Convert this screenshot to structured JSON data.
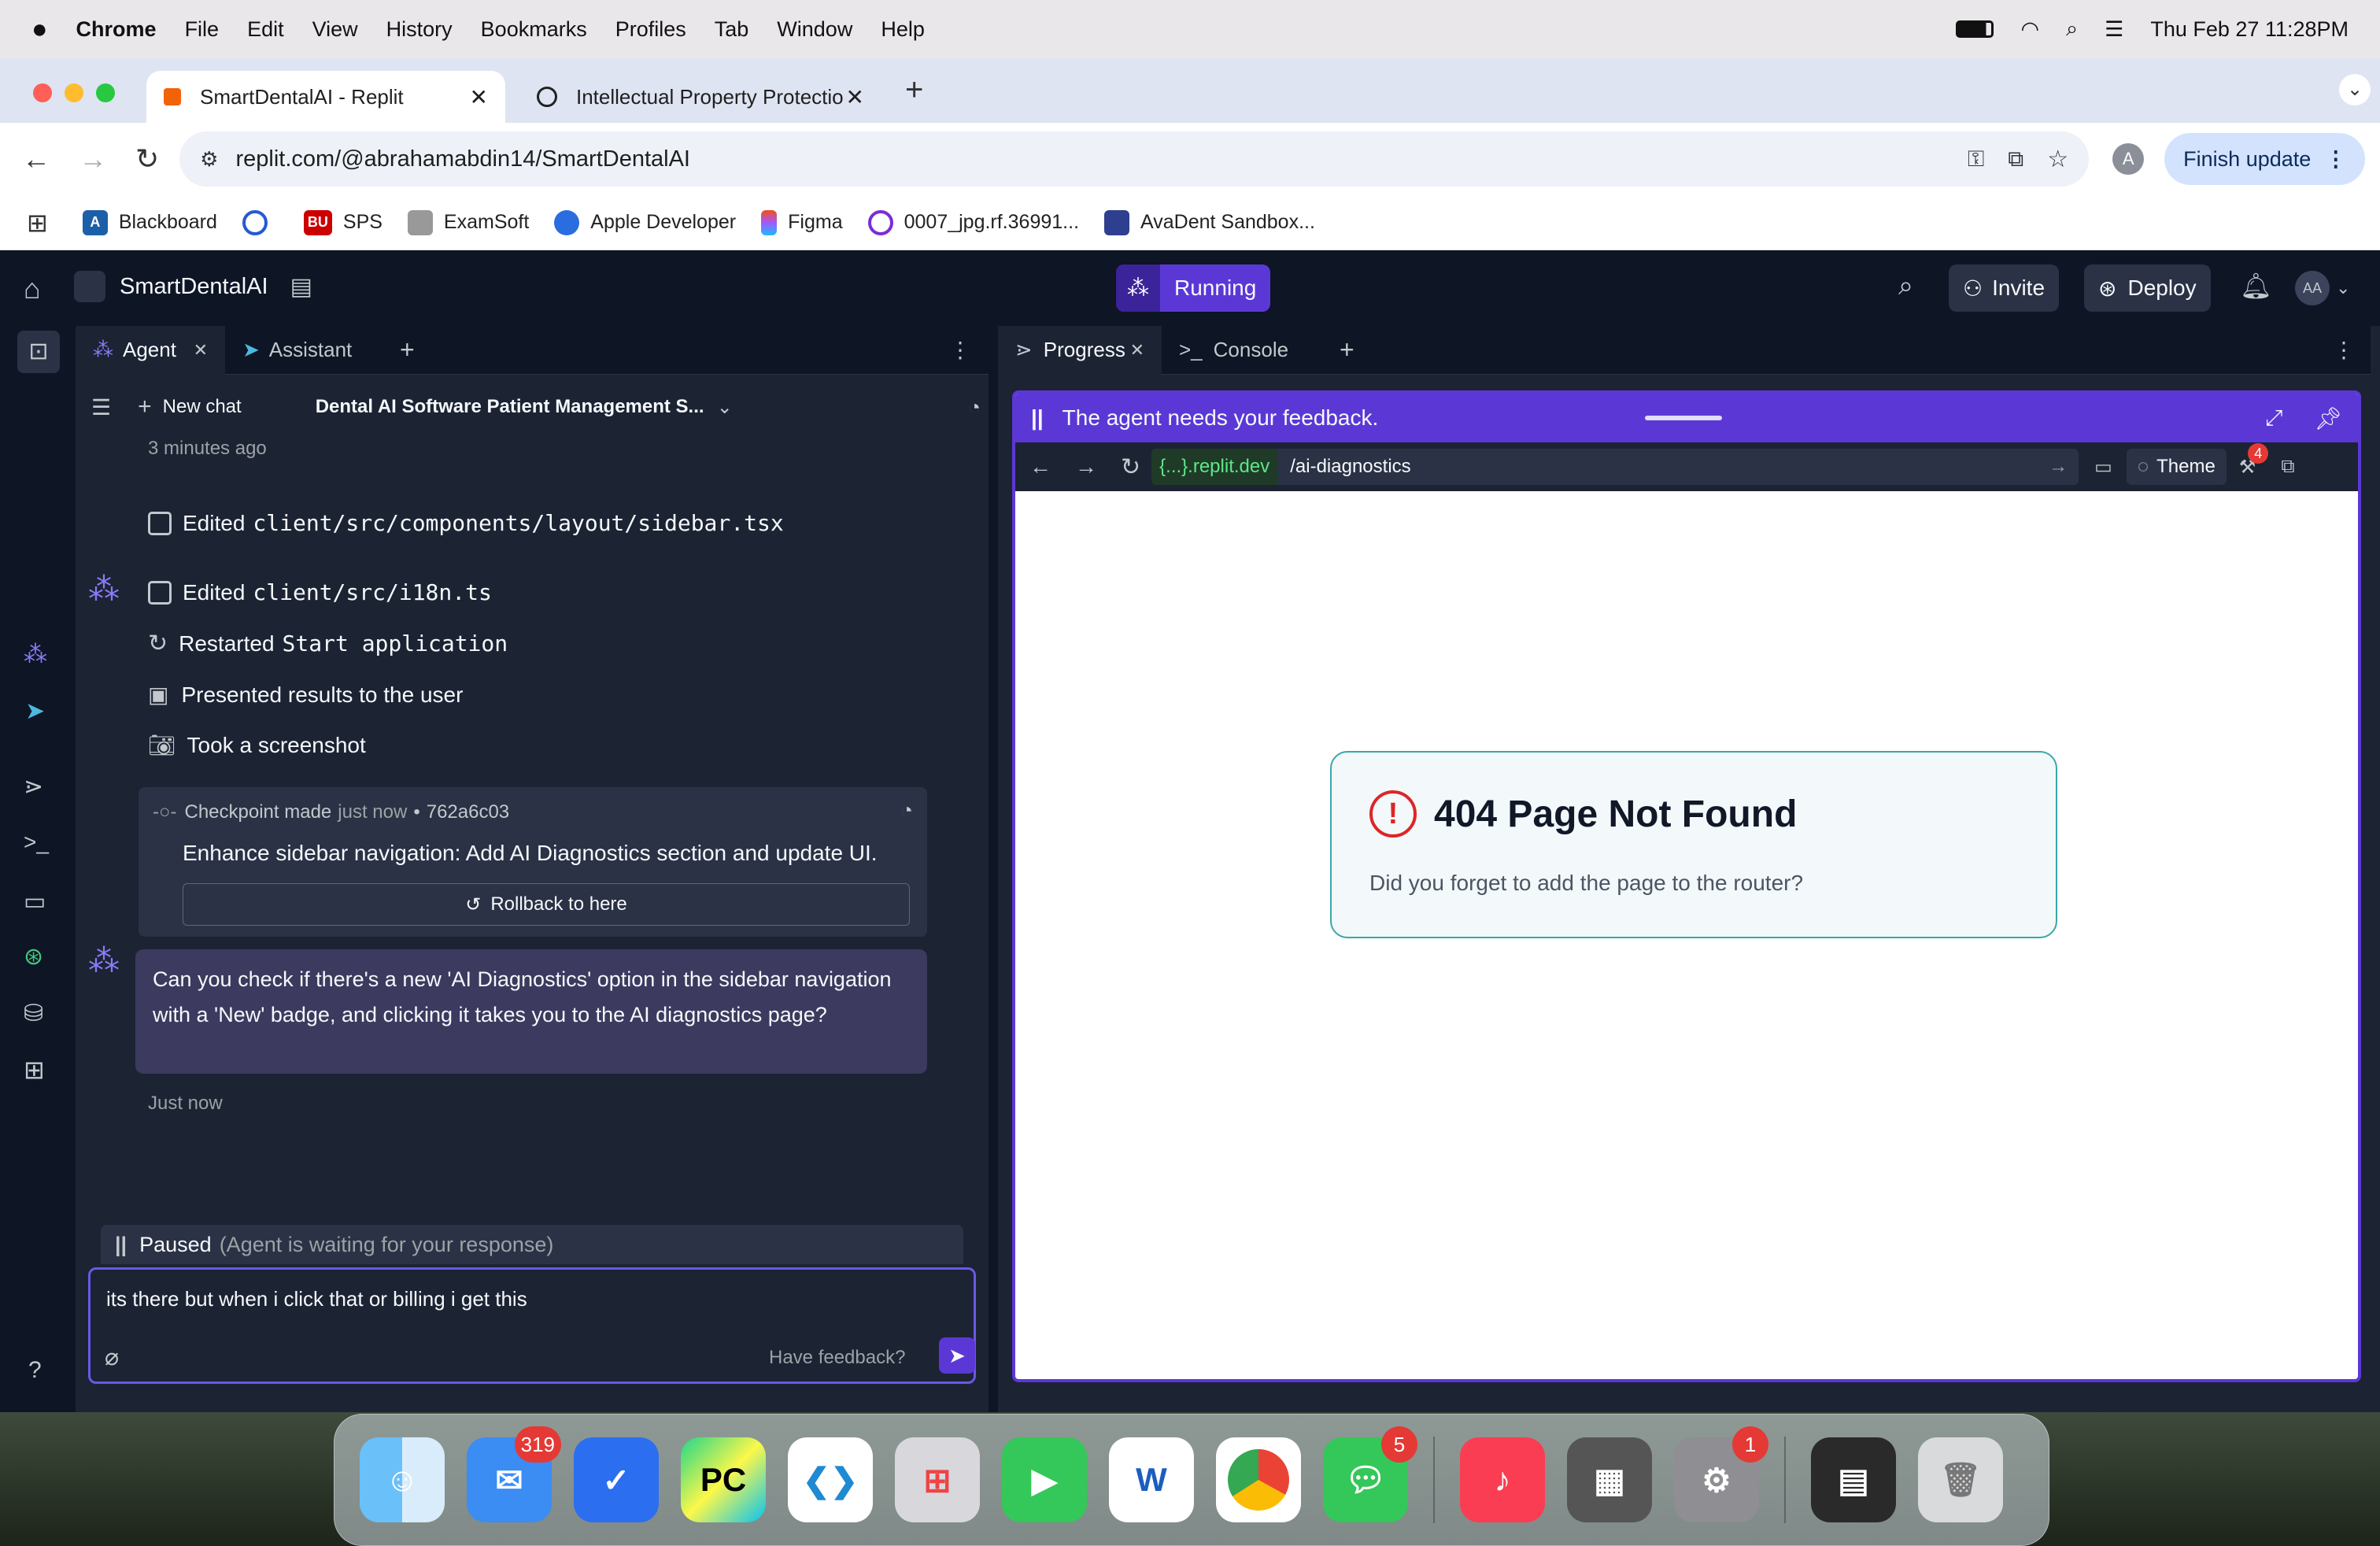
{
  "menubar": {
    "app": "Chrome",
    "items": [
      "File",
      "Edit",
      "View",
      "History",
      "Bookmarks",
      "Profiles",
      "Tab",
      "Window",
      "Help"
    ],
    "clock": "Thu Feb 27  11:28PM"
  },
  "chrome": {
    "tabs": [
      {
        "title": "SmartDentalAI - Replit"
      },
      {
        "title": "Intellectual Property Protectio"
      }
    ],
    "url": "replit.com/@abrahamabdin14/SmartDentalAI",
    "profile_initial": "A",
    "finish_update": "Finish update",
    "bookmarks": [
      "Blackboard",
      "SPS",
      "ExamSoft",
      "Apple Developer",
      "Figma",
      "0007_jpg.rf.36991...",
      "AvaDent Sandbox..."
    ]
  },
  "replit": {
    "project": "SmartDentalAI",
    "status": "Running",
    "invite": "Invite",
    "deploy": "Deploy",
    "avatar": "AA"
  },
  "agent_pane": {
    "tabs": [
      "Agent",
      "Assistant"
    ],
    "new_chat": "New chat",
    "chat_title": "Dental AI Software Patient Management S...",
    "time_ago": "3 minutes ago",
    "actions_top": [
      {
        "verb": "Edited",
        "target": "client/src/components/layout/sidebar.tsx"
      }
    ],
    "actions": [
      {
        "verb": "Edited",
        "target": "client/src/i18n.ts"
      },
      {
        "verb": "Restarted",
        "target": "Start application"
      },
      {
        "verb": "Presented results to the user",
        "target": ""
      },
      {
        "verb": "Took a screenshot",
        "target": ""
      }
    ],
    "checkpoint": {
      "label": "Checkpoint made",
      "when": "just now",
      "hash": "762a6c03",
      "message": "Enhance sidebar navigation: Add AI Diagnostics section and update UI.",
      "rollback": "Rollback to here"
    },
    "agent_question": "Can you check if there's a new 'AI Diagnostics' option in the sidebar navigation with a 'New' badge, and clicking it takes you to the AI diagnostics page?",
    "question_time": "Just now",
    "paused": "Paused",
    "paused_note": "(Agent is waiting for your response)",
    "input_value": "its there but when i click that or billing i get this",
    "feedback": "Have feedback?"
  },
  "right_pane": {
    "tabs": [
      "Progress",
      "Console"
    ],
    "feedback_banner": "The agent needs your feedback.",
    "domain": "{...}.replit.dev",
    "path": "/ai-diagnostics",
    "theme": "Theme",
    "devtools_badge": "4",
    "error_title": "404 Page Not Found",
    "error_body": "Did you forget to add the page to the router?"
  },
  "dock": {
    "mail_badge": "319",
    "messages_badge": "5",
    "settings_badge": "1"
  },
  "colors": {
    "purple": "#5b38d6",
    "replit_bg": "#1c2333",
    "replit_dark": "#0e1525"
  }
}
